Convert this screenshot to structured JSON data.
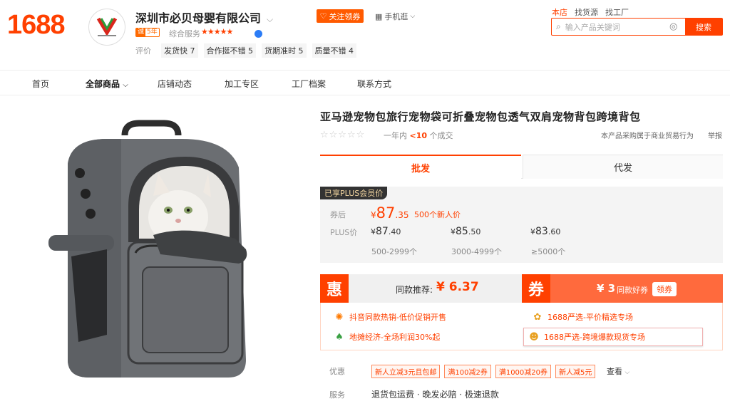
{
  "header": {
    "logo": "1688",
    "shop_name": "深圳市必贝母婴有限公司",
    "follow_button": "关注领券",
    "mobile_link": "手机逛",
    "years_badge": {
      "prefix": "诚",
      "years": "5年"
    },
    "service_label": "综合服务",
    "service_stars": "★★★★★",
    "rating_label": "评价",
    "ratings": [
      {
        "label": "发货快",
        "score": "7"
      },
      {
        "label": "合作挺不错",
        "score": "5"
      },
      {
        "label": "货期准时",
        "score": "5"
      },
      {
        "label": "质量不错",
        "score": "4"
      }
    ],
    "scope_links": [
      "本店",
      "找货源",
      "找工厂"
    ],
    "search": {
      "placeholder": "输入产品关键词",
      "button": "搜索"
    }
  },
  "nav": {
    "items": [
      "首页",
      "全部商品",
      "店铺动态",
      "加工专区",
      "工厂档案",
      "联系方式"
    ]
  },
  "product": {
    "title": "亚马逊宠物包旅行宠物袋可折叠宠物包透气双肩宠物背包跨境背包",
    "sales_prefix": "一年内",
    "sales_count": "<10",
    "sales_suffix": "个成交",
    "trade_note": "本产品采购属于商业贸易行为",
    "report": "举报"
  },
  "tabs": {
    "wholesale": "批发",
    "dropship": "代发"
  },
  "pricing": {
    "plus_tag": "已享PLUS会员价",
    "after_coupon_label": "券后",
    "currency": "¥",
    "after_coupon_int": "87",
    "after_coupon_dec": ".35",
    "new_user_note": "500个新人价",
    "plus_label": "PLUS价",
    "tiers": [
      {
        "int": "87",
        "dec": ".40",
        "range": "500-2999个"
      },
      {
        "int": "85",
        "dec": ".50",
        "range": "3000-4999个"
      },
      {
        "int": "83",
        "dec": ".60",
        "range": "≥5000个"
      }
    ]
  },
  "promo": {
    "hui_char": "惠",
    "recommend_label": "同款推荐:",
    "recommend_price": "¥ 6.37",
    "quan_char": "券",
    "coupon_amount": "¥ 3",
    "coupon_text": "同款好券",
    "coupon_button": "领券"
  },
  "activities": [
    {
      "icon": "sun-icon",
      "text": "抖音同款热销-低价促销开售"
    },
    {
      "icon": "flower-icon",
      "text": "1688严选-平价精选专场"
    },
    {
      "icon": "leaf-icon",
      "text": "地摊经济-全场利润30%起"
    },
    {
      "icon": "tiger-icon",
      "text": "1688严选-跨境爆款现货专场"
    }
  ],
  "discounts": {
    "label": "优惠",
    "chips": [
      "新人立减3元且包邮",
      "满100减2券",
      "满1000减20券",
      "新人减5元"
    ],
    "more": "查看"
  },
  "service": {
    "label": "服务",
    "text": "退货包运费 · 晚发必赔 · 极速退款"
  },
  "colors": {
    "brand": "#ff4000",
    "accent": "#ff6a3d"
  }
}
